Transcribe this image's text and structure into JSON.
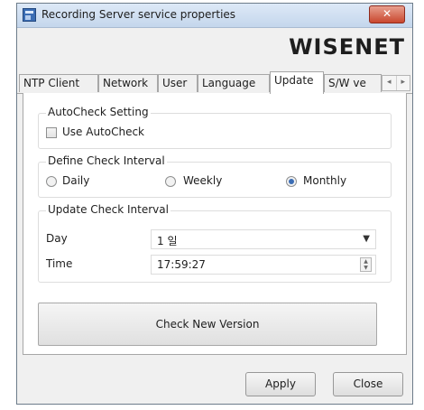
{
  "window": {
    "title": "Recording Server service properties",
    "close_label": "✕"
  },
  "logo": {
    "text": "WISENET"
  },
  "tabs": [
    {
      "label": "NTP Client"
    },
    {
      "label": "Network"
    },
    {
      "label": "User"
    },
    {
      "label": "Language"
    },
    {
      "label": "Update",
      "active": true
    },
    {
      "label": "S/W ve"
    }
  ],
  "tab_scroll": {
    "left": "◂",
    "right": "▸"
  },
  "autocheck": {
    "legend": "AutoCheck Setting",
    "checkbox_label": "Use AutoCheck",
    "checked": false
  },
  "check_interval": {
    "legend": "Define Check Interval",
    "options": [
      {
        "label": "Daily",
        "selected": false
      },
      {
        "label": "Weekly",
        "selected": false
      },
      {
        "label": "Monthly",
        "selected": true
      }
    ]
  },
  "update_interval": {
    "legend": "Update Check Interval",
    "day_label": "Day",
    "day_value": "1 일",
    "time_label": "Time",
    "time_value": "17:59:27"
  },
  "check_button": "Check New Version",
  "footer": {
    "apply": "Apply",
    "close": "Close"
  }
}
